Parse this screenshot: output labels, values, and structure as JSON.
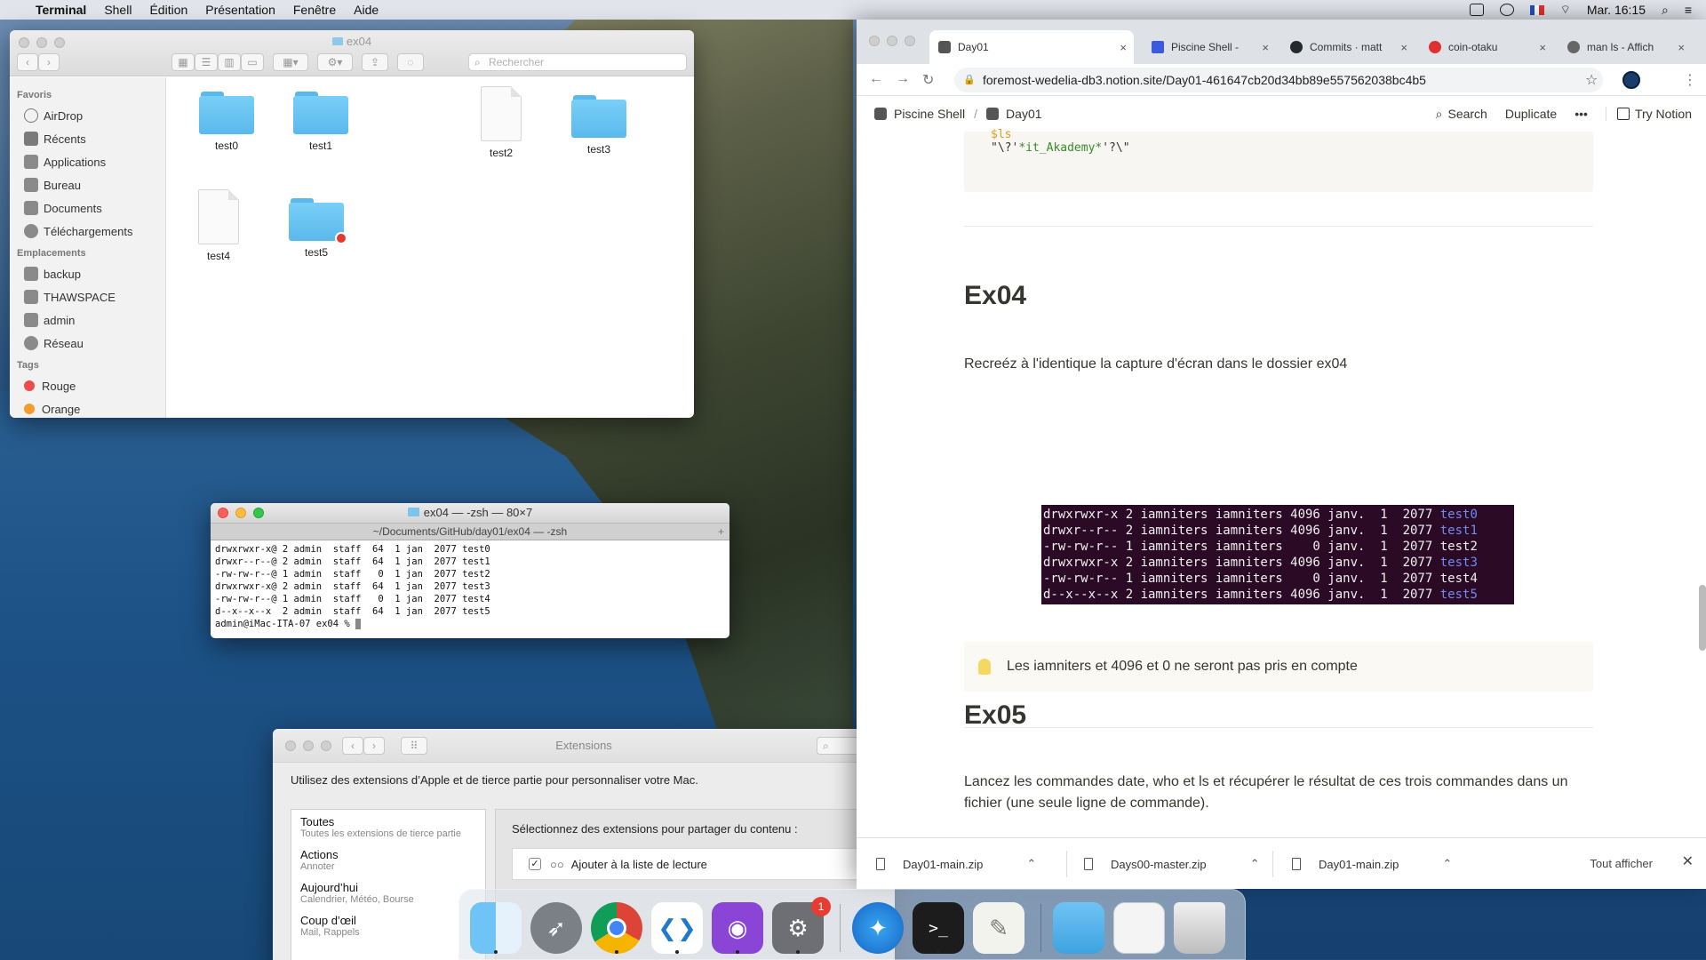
{
  "menubar": {
    "app": "Terminal",
    "items": [
      "Shell",
      "Édition",
      "Présentation",
      "Fenêtre",
      "Aide"
    ],
    "clock": "Mar. 16:15"
  },
  "finder": {
    "title": "ex04",
    "search_placeholder": "Rechercher",
    "sidebar": {
      "favoris_header": "Favoris",
      "favoris": [
        "AirDrop",
        "Récents",
        "Applications",
        "Bureau",
        "Documents",
        "Téléchargements"
      ],
      "emplacements_header": "Emplacements",
      "emplacements": [
        "backup",
        "THAWSPACE",
        "admin",
        "Réseau"
      ],
      "tags_header": "Tags",
      "tags": [
        {
          "label": "Rouge",
          "color": "#f04b4b"
        },
        {
          "label": "Orange",
          "color": "#f59a2c"
        }
      ]
    },
    "files": [
      "test0",
      "test1",
      "test2",
      "test3",
      "test4",
      "test5"
    ]
  },
  "terminal": {
    "title": "ex04 — -zsh — 80×7",
    "tab": "~/Documents/GitHub/day01/ex04 — -zsh",
    "lines": [
      "drwxrwxr-x@ 2 admin  staff  64  1 jan  2077 test0",
      "drwxr--r--@ 2 admin  staff  64  1 jan  2077 test1",
      "-rw-rw-r--@ 1 admin  staff   0  1 jan  2077 test2",
      "drwxrwxr-x@ 2 admin  staff  64  1 jan  2077 test3",
      "-rw-rw-r--@ 1 admin  staff   0  1 jan  2077 test4",
      "d--x--x--x  2 admin  staff  64  1 jan  2077 test5"
    ],
    "prompt": "admin@iMac-ITA-07 ex04 % "
  },
  "extensions": {
    "title": "Extensions",
    "description": "Utilisez des extensions d’Apple et de tierce partie pour personnaliser votre Mac.",
    "categories": [
      {
        "title": "Toutes",
        "subtitle": "Toutes les extensions de tierce partie"
      },
      {
        "title": "Actions",
        "subtitle": "Annoter"
      },
      {
        "title": "Aujourd’hui",
        "subtitle": "Calendrier, Météo, Bourse"
      },
      {
        "title": "Coup d’œil",
        "subtitle": "Mail, Rappels"
      }
    ],
    "panel_heading": "Sélectionnez des extensions pour partager du contenu :",
    "share_item": "Ajouter à la liste de lecture"
  },
  "chrome": {
    "tabs": [
      {
        "label": "Day01",
        "color": "#555555"
      },
      {
        "label": "Piscine Shell - ",
        "color": "#3b5bdb"
      },
      {
        "label": "Commits · matt",
        "color": "#24292e"
      },
      {
        "label": "coin-otaku",
        "color": "#e03131"
      },
      {
        "label": "man ls - Affich",
        "color": "#666666"
      }
    ],
    "url": "foremost-wedelia-db3.notion.site/Day01-461647cb20d34bb89e557562038bc4b5",
    "breadcrumb": [
      "Piscine Shell",
      "/",
      "Day01"
    ],
    "actions": {
      "search": "Search",
      "duplicate": "Duplicate",
      "more": "•••",
      "try": "Try Notion"
    },
    "code_prev": {
      "ls": "$ls",
      "line": "\"\\?'",
      "green": "*it_Akademy*",
      "tail": "'?\\\""
    },
    "ex04": {
      "heading": "Ex04",
      "text": "Recreéz à l'identique la capture d'écran dans le dossier ex04",
      "ls_lines": [
        {
          "prefix": "drwxrwxr-x 2 iamniters iamniters 4096 janv.  1  2077 ",
          "name": "test0",
          "dir": true
        },
        {
          "prefix": "drwxr--r-- 2 iamniters iamniters 4096 janv.  1  2077 ",
          "name": "test1",
          "dir": true
        },
        {
          "prefix": "-rw-rw-r-- 1 iamniters iamniters    0 janv.  1  2077 ",
          "name": "test2",
          "dir": false
        },
        {
          "prefix": "drwxrwxr-x 2 iamniters iamniters 4096 janv.  1  2077 ",
          "name": "test3",
          "dir": true
        },
        {
          "prefix": "-rw-rw-r-- 1 iamniters iamniters    0 janv.  1  2077 ",
          "name": "test4",
          "dir": false
        },
        {
          "prefix": "d--x--x--x 2 iamniters iamniters 4096 janv.  1  2077 ",
          "name": "test5",
          "dir": true
        }
      ],
      "callout": "Les iamniters et 4096 et 0 ne seront pas pris en compte"
    },
    "ex05": {
      "heading": "Ex05",
      "text": "Lancez les commandes date, who et ls et récupérer le résultat de ces trois commandes dans un fichier (une seule ligne de commande)."
    },
    "downloads": [
      "Day01-main.zip",
      "Days00-master.zip",
      "Day01-main.zip"
    ],
    "show_all": "Tout afficher"
  },
  "dock": {
    "badge": "1"
  }
}
